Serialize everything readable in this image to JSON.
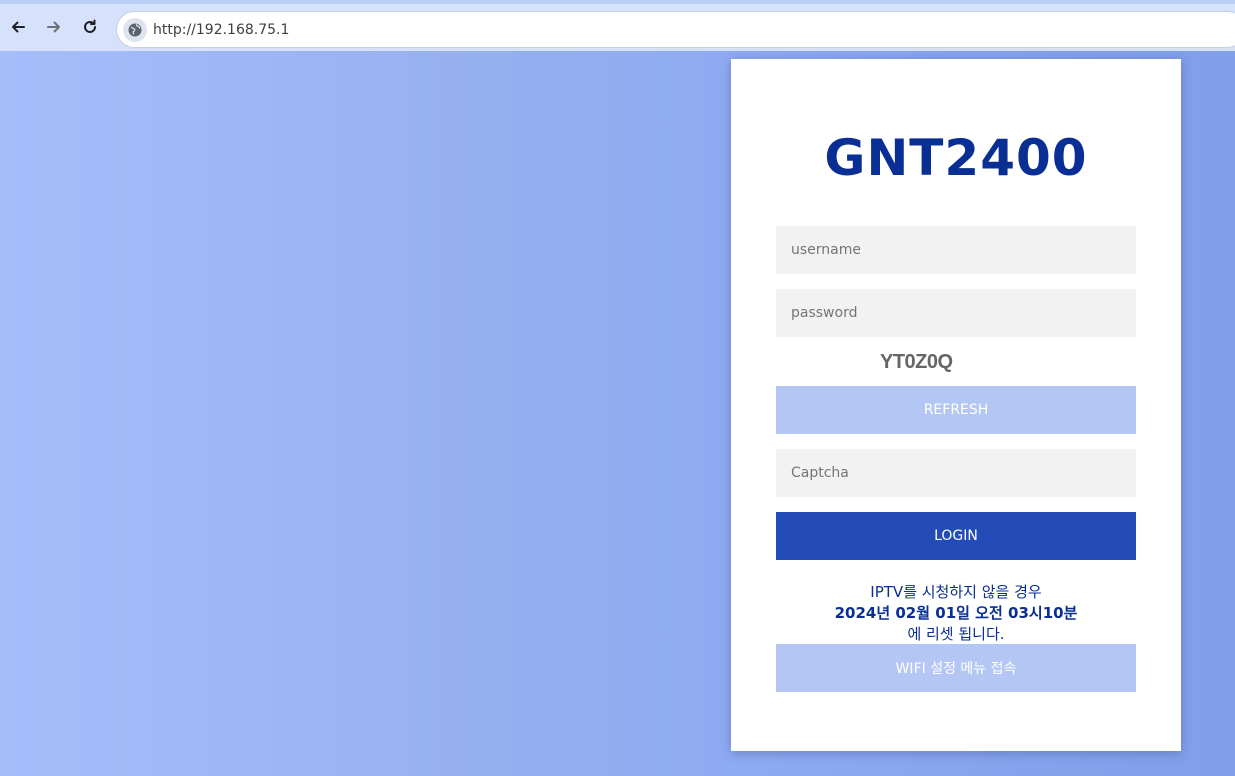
{
  "browser": {
    "url": "http://192.168.75.1",
    "icons": {
      "back": "arrow-left-icon",
      "forward": "arrow-right-icon",
      "reload": "reload-icon",
      "site": "globe-icon"
    }
  },
  "login": {
    "title": "GNT2400",
    "username_placeholder": "username",
    "password_placeholder": "password",
    "captcha_code": "YT0Z0Q",
    "refresh_label": "REFRESH",
    "captcha_placeholder": "Captcha",
    "login_label": "LOGIN",
    "notice_line1": "IPTV를 시청하지 않을 경우",
    "notice_year": "2024",
    "notice_year_unit": "년 ",
    "notice_month": "02",
    "notice_month_unit": "월 ",
    "notice_day": "01",
    "notice_day_unit": "일 오전 ",
    "notice_hour": "03",
    "notice_hour_unit": "시",
    "notice_minute": "10",
    "notice_minute_unit": "분",
    "notice_line3": "에 리셋 됩니다.",
    "wifi_label": "WIFI 설정 메뉴 접속"
  },
  "colors": {
    "title": "#0a2f94",
    "login_button": "#244cb6",
    "secondary_button": "#b4c7f4",
    "field_background": "#f2f2f2"
  }
}
